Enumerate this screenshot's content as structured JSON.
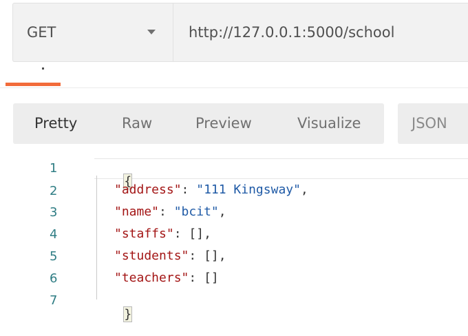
{
  "request": {
    "method": "GET",
    "url": "http://127.0.0.1:5000/school"
  },
  "response_views": {
    "buttons": [
      "Pretty",
      "Raw",
      "Preview",
      "Visualize"
    ],
    "active": "Pretty",
    "format": "JSON"
  },
  "code": {
    "line_numbers": [
      "1",
      "2",
      "3",
      "4",
      "5",
      "6",
      "7"
    ],
    "open_brace": "{",
    "close_brace": "}",
    "entries": [
      {
        "key": "\"address\"",
        "value": "\"111 Kingsway\"",
        "suffix": ","
      },
      {
        "key": "\"name\"",
        "value": "\"bcit\"",
        "suffix": ","
      },
      {
        "key": "\"staffs\"",
        "value": "[]",
        "suffix": ","
      },
      {
        "key": "\"students\"",
        "value": "[]",
        "suffix": ","
      },
      {
        "key": "\"teachers\"",
        "value": "[]",
        "suffix": ""
      }
    ]
  },
  "colors": {
    "accent": "#f26b3a",
    "line_number": "#2f7d84",
    "json_key": "#a31515",
    "json_string": "#1f5aa6"
  }
}
